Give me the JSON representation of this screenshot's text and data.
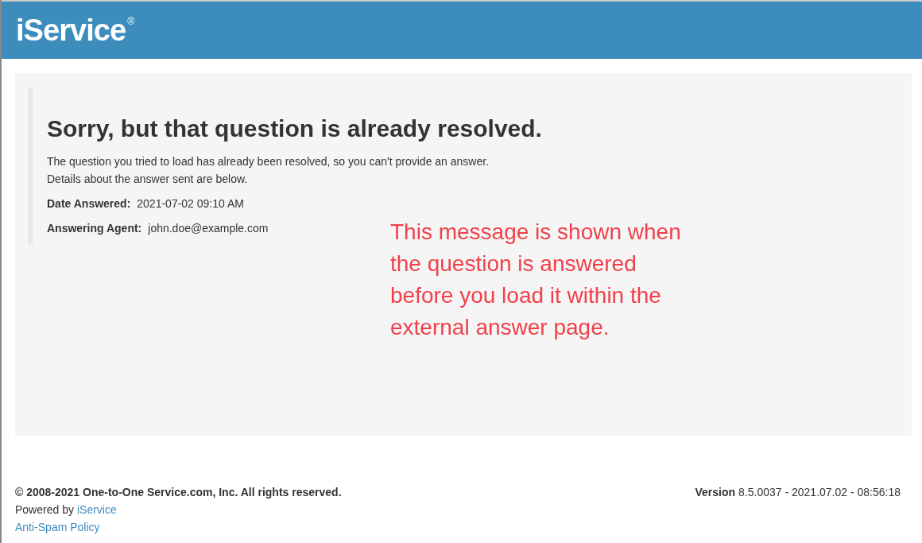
{
  "header": {
    "logo": "iService",
    "logo_mark": "®"
  },
  "message": {
    "title": "Sorry, but that question is already resolved.",
    "lines": [
      "The question you tried to load has already been resolved, so you can't provide an answer.",
      "Details about the answer sent are below."
    ],
    "details": [
      {
        "label": "Date Answered:",
        "value": "2021-07-02 09:10 AM"
      },
      {
        "label": "Answering Agent:",
        "value": "john.doe@example.com"
      }
    ]
  },
  "annotation": "This message is shown when the question is answered before you load it within the external answer page.",
  "footer": {
    "copyright": "© 2008-2021 One-to-One Service.com, Inc. All rights reserved.",
    "powered_by": "Powered by",
    "powered_link": "iService",
    "policy_link": "Anti-Spam Policy",
    "version_label": "Version",
    "version": "8.5.0037 - 2021.07.02 - 08:56:18"
  }
}
